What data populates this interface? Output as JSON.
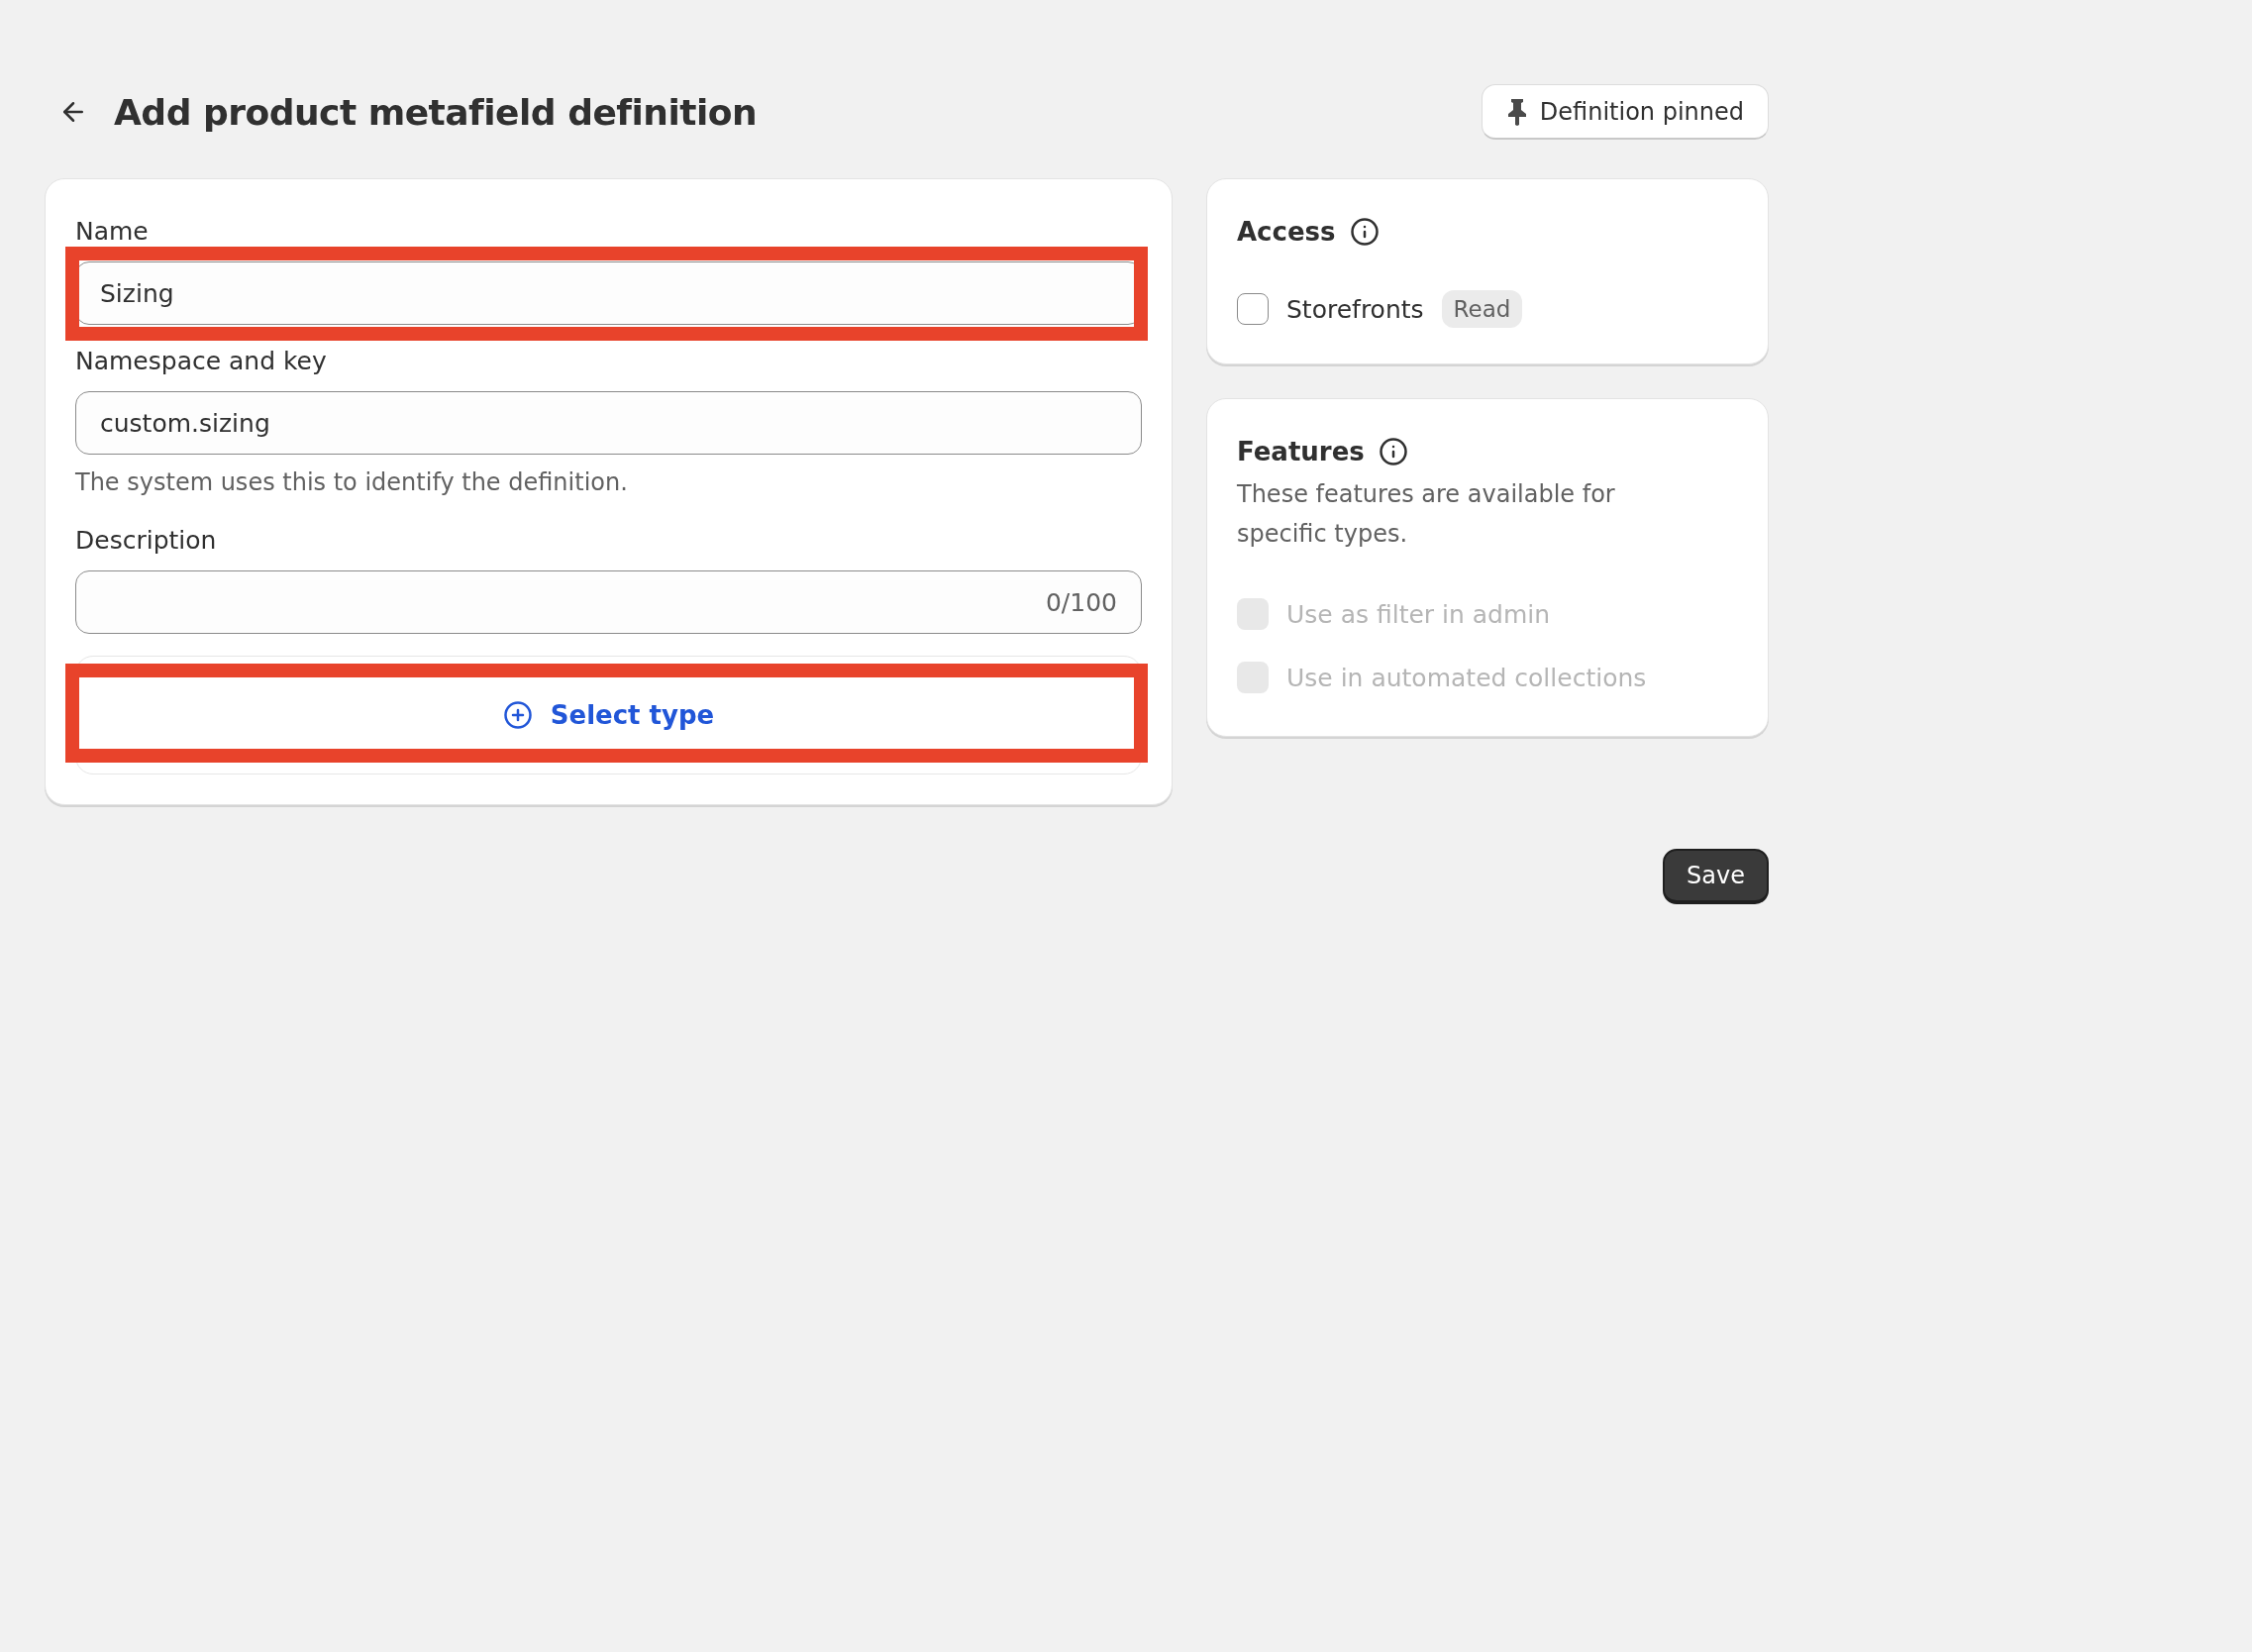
{
  "header": {
    "title": "Add product metafield definition",
    "pin_button": "Definition pinned"
  },
  "form": {
    "name": {
      "label": "Name",
      "value": "Sizing",
      "highlighted": true
    },
    "namespace": {
      "label": "Namespace and key",
      "value": "custom.sizing",
      "help": "The system uses this to identify the definition."
    },
    "description": {
      "label": "Description",
      "counter": "0/100"
    },
    "select_type": {
      "label": "Select type",
      "highlighted": true
    }
  },
  "access": {
    "title": "Access",
    "options": [
      {
        "label": "Storefronts",
        "badge": "Read",
        "checked": false,
        "disabled": false
      }
    ]
  },
  "features": {
    "title": "Features",
    "description": "These features are available for specific types.",
    "options": [
      {
        "label": "Use as filter in admin",
        "checked": false,
        "disabled": true
      },
      {
        "label": "Use in automated collections",
        "checked": false,
        "disabled": true
      }
    ]
  },
  "save_button": "Save"
}
